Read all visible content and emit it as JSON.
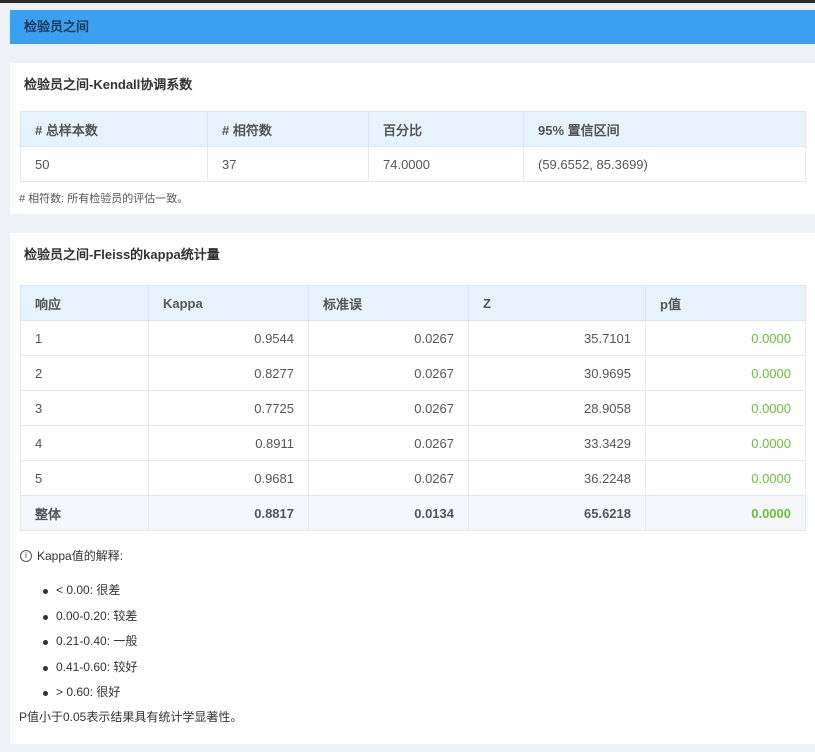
{
  "header": {
    "title": "检验员之间"
  },
  "kendall": {
    "title": "检验员之间-Kendall协调系数",
    "columns": [
      "# 总样本数",
      "# 相符数",
      "百分比",
      "95% 置信区间"
    ],
    "row": [
      "50",
      "37",
      "74.0000",
      "(59.6552, 85.3699)"
    ],
    "note": "# 相符数: 所有检验员的评估一致。"
  },
  "fleiss": {
    "title": "检验员之间-Fleiss的kappa统计量",
    "columns": [
      "响应",
      "Kappa",
      "标准误",
      "Z",
      "p值"
    ],
    "rows": [
      [
        "1",
        "0.9544",
        "0.0267",
        "35.7101",
        "0.0000"
      ],
      [
        "2",
        "0.8277",
        "0.0267",
        "30.9695",
        "0.0000"
      ],
      [
        "3",
        "0.7725",
        "0.0267",
        "28.9058",
        "0.0000"
      ],
      [
        "4",
        "0.8911",
        "0.0267",
        "33.3429",
        "0.0000"
      ],
      [
        "5",
        "0.9681",
        "0.0267",
        "36.2248",
        "0.0000"
      ]
    ],
    "total": [
      "整体",
      "0.8817",
      "0.0134",
      "65.6218",
      "0.0000"
    ]
  },
  "interpretation": {
    "title": "Kappa值的解释:",
    "levels": [
      "< 0.00: 很差",
      "0.00-0.20: 较差",
      "0.21-0.40: 一般",
      "0.41-0.60: 较好",
      "> 0.60: 很好"
    ],
    "p_note": "P值小于0.05表示结果具有统计学显著性。"
  },
  "colors": {
    "header_bar": "#3ca0f0",
    "table_header": "#e6f3fe",
    "pvalue": "#6abf3a"
  },
  "icons": {
    "info": "info-circle-icon"
  }
}
